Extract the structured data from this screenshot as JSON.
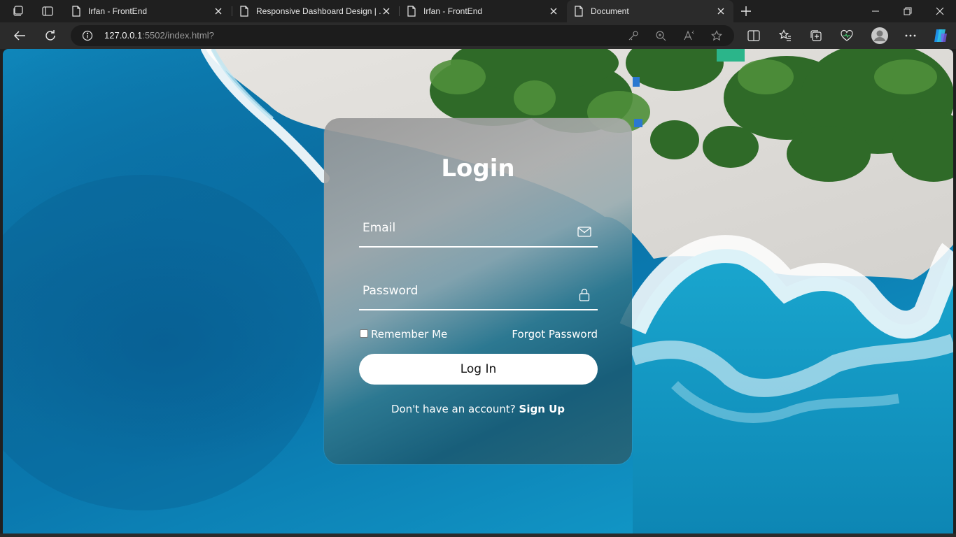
{
  "browser": {
    "tabs": [
      {
        "label": "Irfan - FrontEnd",
        "active": false
      },
      {
        "label": "Responsive Dashboard Design | ...",
        "active": false
      },
      {
        "label": "Irfan - FrontEnd",
        "active": false
      },
      {
        "label": "Document",
        "active": true
      }
    ],
    "address": {
      "host": "127.0.0.1",
      "rest": ":5502/index.html?"
    },
    "icons": [
      "workspaces-icon",
      "tab-actions-icon",
      "new-tab-icon",
      "back-icon",
      "refresh-icon",
      "site-info-icon",
      "key-icon",
      "zoom-icon",
      "read-aloud-icon",
      "favorite-icon",
      "split-screen-icon",
      "favorites-icon",
      "collections-icon",
      "browser-essentials-icon",
      "profile-icon",
      "more-icon",
      "copilot-icon"
    ]
  },
  "login": {
    "title": "Login",
    "email_label": "Email",
    "password_label": "Password",
    "remember_label": "Remember Me",
    "forgot_label": "Forgot Password",
    "submit_label": "Log In",
    "signup_prompt": "Don't have an account?",
    "signup_link": "Sign Up"
  },
  "colors": {
    "chrome_dark": "#1f1f1f",
    "toolbar": "#2b2b2b",
    "ocean": "#0b6ea0",
    "sand": "#dcdcdc",
    "foliage": "#2e6b2a",
    "button_bg": "#ffffff"
  }
}
